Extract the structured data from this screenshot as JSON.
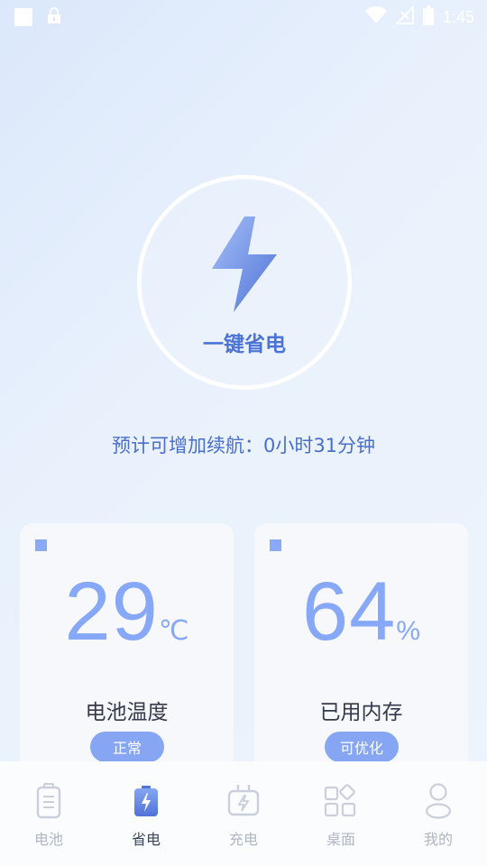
{
  "status_bar": {
    "time": "1:45",
    "icons": [
      "notification-square-icon",
      "lock-icon",
      "wifi-icon",
      "signal-icon",
      "battery-icon"
    ]
  },
  "power_button": {
    "label": "一键省电",
    "icon": "lightning-bolt-icon"
  },
  "estimate": {
    "text": "预计可增加续航：0小时31分钟"
  },
  "cards": [
    {
      "value": "29",
      "unit": "℃",
      "label": "电池温度",
      "badge": "正常"
    },
    {
      "value": "64",
      "unit": "%",
      "label": "已用内存",
      "badge": "可优化"
    }
  ],
  "tabs": [
    {
      "label": "电池",
      "icon": "battery-icon",
      "active": false
    },
    {
      "label": "省电",
      "icon": "battery-bolt-icon",
      "active": true
    },
    {
      "label": "充电",
      "icon": "charger-icon",
      "active": false
    },
    {
      "label": "桌面",
      "icon": "grid-icon",
      "active": false
    },
    {
      "label": "我的",
      "icon": "user-icon",
      "active": false
    }
  ],
  "colors": {
    "accent": "#4b73d6",
    "card_value": "#87a8f6",
    "badge": "#86a6f3",
    "tab_active": "#3b4458",
    "tab_inactive": "#aeb5c4"
  }
}
